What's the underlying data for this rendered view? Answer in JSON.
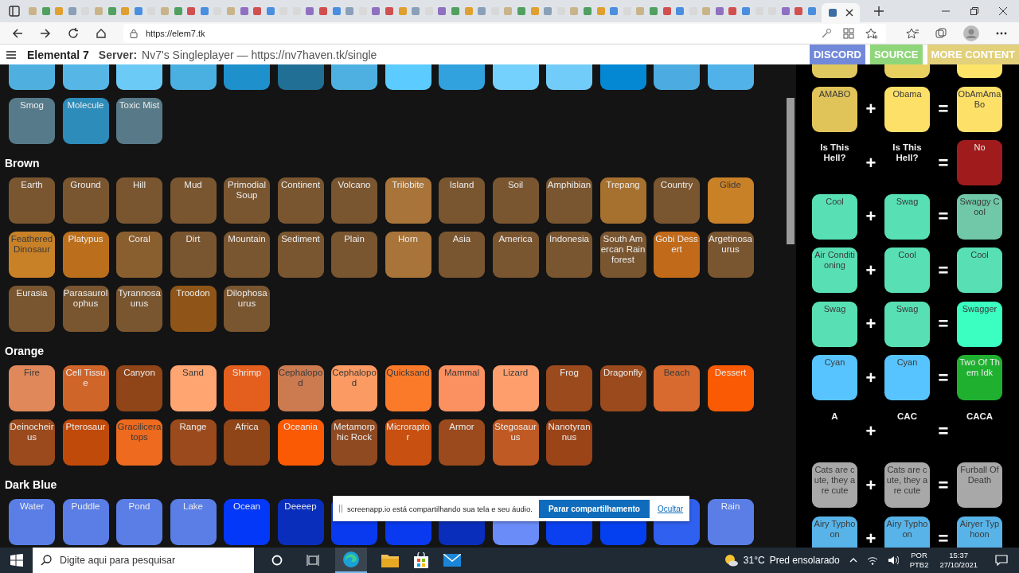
{
  "browser": {
    "url": "https://elem7.tk"
  },
  "header": {
    "title": "Elemental 7",
    "server_label": "Server:",
    "server": "Nv7's Singleplayer — https://nv7haven.tk/single",
    "buttons": [
      {
        "label": "DISCORD",
        "color": "#7289da"
      },
      {
        "label": "SOURCE",
        "color": "#8fd67a"
      },
      {
        "label": "MORE CONTENT",
        "color": "#e2d07a"
      }
    ]
  },
  "sections": [
    {
      "items": [
        {
          "color": "#4fb0e0"
        },
        {
          "color": "#56b6e6"
        },
        {
          "color": "#6ccaf6"
        },
        {
          "color": "#4ab0e2"
        },
        {
          "color": "#1e90cc"
        },
        {
          "color": "#226f96"
        },
        {
          "color": "#4eb0e0"
        },
        {
          "color": "#5ccbff"
        },
        {
          "color": "#32a2de"
        },
        {
          "color": "#74d0fc"
        },
        {
          "color": "#72ccfa"
        },
        {
          "color": "#0488d4"
        },
        {
          "color": "#4cabe0"
        },
        {
          "color": "#50b2e8"
        },
        {
          "name": "Smog",
          "color": "#567a8a"
        },
        {
          "name": "Molecule",
          "color": "#2d8cba"
        },
        {
          "name": "Toxic Mist",
          "color": "#587a88"
        }
      ]
    },
    {
      "heading": "Brown",
      "items": [
        {
          "name": "Earth",
          "color": "#7a5630"
        },
        {
          "name": "Ground",
          "color": "#7a5630"
        },
        {
          "name": "Hill",
          "color": "#7a5630"
        },
        {
          "name": "Mud",
          "color": "#7a5630"
        },
        {
          "name": "Primodial Soup",
          "color": "#7a5630"
        },
        {
          "name": "Continent",
          "color": "#7a5630"
        },
        {
          "name": "Volcano",
          "color": "#7a5630"
        },
        {
          "name": "Trilobite",
          "color": "#a8743a"
        },
        {
          "name": "Island",
          "color": "#7a5630"
        },
        {
          "name": "Soil",
          "color": "#7a5630"
        },
        {
          "name": "Amphibian",
          "color": "#7a5630"
        },
        {
          "name": "Trepang",
          "color": "#a6702f"
        },
        {
          "name": "Country",
          "color": "#7a5630"
        },
        {
          "name": "Glide",
          "color": "#c98128"
        },
        {
          "name": "Feathered Dinosaur",
          "color": "#c98128"
        },
        {
          "name": "Platypus",
          "color": "#bb6f1c"
        },
        {
          "name": "Coral",
          "color": "#8a5f2f"
        },
        {
          "name": "Dirt",
          "color": "#7a5630"
        },
        {
          "name": "Mountain",
          "color": "#7a5630"
        },
        {
          "name": "Sediment",
          "color": "#7a5630"
        },
        {
          "name": "Plain",
          "color": "#7a5630"
        },
        {
          "name": "Horn",
          "color": "#a8743a"
        },
        {
          "name": "Asia",
          "color": "#7a5630"
        },
        {
          "name": "America",
          "color": "#7a5630"
        },
        {
          "name": "Indonesia",
          "color": "#7a5630"
        },
        {
          "name": "South Amercan Rainforest",
          "color": "#7a5630"
        },
        {
          "name": "Gobi Dessert",
          "color": "#c06a1a"
        },
        {
          "name": "Argetinosaurus",
          "color": "#7a5630"
        },
        {
          "name": "Eurasia",
          "color": "#7a5630"
        },
        {
          "name": "Parasaurolophus",
          "color": "#7a5630"
        },
        {
          "name": "Tyrannosaurus",
          "color": "#7a5630"
        },
        {
          "name": "Troodon",
          "color": "#8f5518"
        },
        {
          "name": "Dilophosaurus",
          "color": "#7a5630"
        }
      ]
    },
    {
      "heading": "Orange",
      "items": [
        {
          "name": "Fire",
          "color": "#e0885a"
        },
        {
          "name": "Cell Tissue",
          "color": "#d0652a"
        },
        {
          "name": "Canyon",
          "color": "#8f4518"
        },
        {
          "name": "Sand",
          "color": "#ffa572"
        },
        {
          "name": "Shrimp",
          "color": "#e45f1e"
        },
        {
          "name": "Cephalopod",
          "color": "#cc7a50"
        },
        {
          "name": "Cephalopod",
          "color": "#fb9a62"
        },
        {
          "name": "Quicksand",
          "color": "#fb7a2a"
        },
        {
          "name": "Mammal",
          "color": "#fb9060"
        },
        {
          "name": "Lizard",
          "color": "#fd9e6c"
        },
        {
          "name": "Frog",
          "color": "#9a4a1c"
        },
        {
          "name": "Dragonfly",
          "color": "#9a4a1c"
        },
        {
          "name": "Beach",
          "color": "#d86a30"
        },
        {
          "name": "Dessert",
          "color": "#fb5a04"
        },
        {
          "name": "Deinocheirus",
          "color": "#9a4a1c"
        },
        {
          "name": "Pterosaur",
          "color": "#c04a0a"
        },
        {
          "name": "Gracilicera tops",
          "color": "#ee6a1e"
        },
        {
          "name": "Range",
          "color": "#9a4a1c"
        },
        {
          "name": "Africa",
          "color": "#8f4518"
        },
        {
          "name": "Oceania",
          "color": "#fa5a04"
        },
        {
          "name": "Metamorphic Rock",
          "color": "#8f4a22"
        },
        {
          "name": "Microraptor",
          "color": "#c85010"
        },
        {
          "name": "Armor",
          "color": "#9a4a1c"
        },
        {
          "name": "Stegosaurus",
          "color": "#c05a24"
        },
        {
          "name": "Nanotyrannus",
          "color": "#9a4418"
        }
      ]
    },
    {
      "heading": "Dark Blue",
      "items": [
        {
          "name": "Water",
          "color": "#5a7ee6"
        },
        {
          "name": "Puddle",
          "color": "#5a7ee6"
        },
        {
          "name": "Pond",
          "color": "#5a7ee6"
        },
        {
          "name": "Lake",
          "color": "#5a7ee6"
        },
        {
          "name": "Ocean",
          "color": "#0438f8"
        },
        {
          "name": "Deeeep",
          "color": "#0a2ebc"
        },
        {
          "color": "#0a3af0"
        },
        {
          "color": "#0a3af0"
        },
        {
          "color": "#0a2ebc"
        },
        {
          "color": "#6a8cf8"
        },
        {
          "color": "#0a40f0"
        },
        {
          "color": "#0440f0"
        },
        {
          "color": "#3060f0"
        },
        {
          "name": "Rain",
          "color": "#5a7ee6"
        }
      ]
    }
  ],
  "screen_share_bar": {
    "text": "screenapp.io está compartilhando sua tela e seu áudio.",
    "button": "Parar compartilhamento",
    "link": "Ocultar"
  },
  "combos": [
    {
      "inputs": [
        {
          "kind": "tile",
          "color": "#e0c860"
        },
        {
          "kind": "tile",
          "color": "#e8d060"
        }
      ],
      "result": {
        "kind": "tile",
        "color": "#fde468"
      }
    },
    {
      "inputs": [
        {
          "kind": "tile",
          "name": "AMABO",
          "color": "#e0c45a"
        },
        {
          "kind": "tile",
          "name": "Obama",
          "color": "#fde068"
        }
      ],
      "plus": "+",
      "equals": "=",
      "result": {
        "kind": "tile",
        "name": "ObAmAmaBo",
        "color": "#fde068"
      }
    },
    {
      "inputs": [
        {
          "kind": "text",
          "name": "Is This Hell?"
        },
        {
          "kind": "text",
          "name": "Is This Hell?"
        }
      ],
      "plus": "+",
      "equals": "=",
      "result": {
        "kind": "tile",
        "name": "No",
        "color": "#a01c1c"
      }
    },
    {
      "inputs": [
        {
          "kind": "tile",
          "name": "Cool",
          "color": "#58e0b4"
        },
        {
          "kind": "tile",
          "name": "Swag",
          "color": "#58e0b4"
        }
      ],
      "plus": "+",
      "equals": "=",
      "result": {
        "kind": "tile",
        "name": "Swaggy Cool",
        "color": "#70c8a8"
      }
    },
    {
      "inputs": [
        {
          "kind": "tile",
          "name": "Air Conditioning",
          "color": "#58e0b4"
        },
        {
          "kind": "tile",
          "name": "Cool",
          "color": "#58e0b4"
        }
      ],
      "plus": "+",
      "equals": "=",
      "result": {
        "kind": "tile",
        "name": "Cool",
        "color": "#58e0b4"
      }
    },
    {
      "inputs": [
        {
          "kind": "tile",
          "name": "Swag",
          "color": "#58e0b4"
        },
        {
          "kind": "tile",
          "name": "Swag",
          "color": "#58e0b4"
        }
      ],
      "plus": "+",
      "equals": "=",
      "result": {
        "kind": "tile",
        "name": "Swagger",
        "color": "#3affc0"
      }
    },
    {
      "inputs": [
        {
          "kind": "tile",
          "name": "Cyan",
          "color": "#58c4ff"
        },
        {
          "kind": "tile",
          "name": "Cyan",
          "color": "#58c4ff"
        }
      ],
      "plus": "+",
      "equals": "=",
      "result": {
        "kind": "tile",
        "name": "Two Of Them Idk",
        "color": "#20b030"
      }
    },
    {
      "inputs": [
        {
          "kind": "text",
          "name": "A"
        },
        {
          "kind": "text",
          "name": "CAC"
        }
      ],
      "plus": "+",
      "equals": "=",
      "result": {
        "kind": "text",
        "name": "CACA"
      }
    },
    {
      "inputs": [
        {
          "kind": "tile",
          "name": "Cats are cute, they are cute",
          "color": "#a8a8a8"
        },
        {
          "kind": "tile",
          "name": "Cats are cute, they are cute",
          "color": "#a8a8a8"
        }
      ],
      "plus": "+",
      "equals": "=",
      "result": {
        "kind": "tile",
        "name": "Furball Of Death",
        "color": "#a8a8a8"
      }
    },
    {
      "inputs": [
        {
          "kind": "tile",
          "name": "Airy Typhoon",
          "color": "#58b4e8"
        },
        {
          "kind": "tile",
          "name": "Airy Typhoon",
          "color": "#58b4e8"
        }
      ],
      "plus": "+",
      "equals": "=",
      "result": {
        "kind": "tile",
        "name": "Airyer Typhoon",
        "color": "#58b4e8"
      }
    }
  ],
  "taskbar": {
    "search_placeholder": "Digite aqui para pesquisar",
    "weather": "31°C",
    "weather_text": "Pred ensolarado",
    "language": "POR",
    "layout": "PTB2",
    "time": "15:37",
    "date": "27/10/2021"
  }
}
